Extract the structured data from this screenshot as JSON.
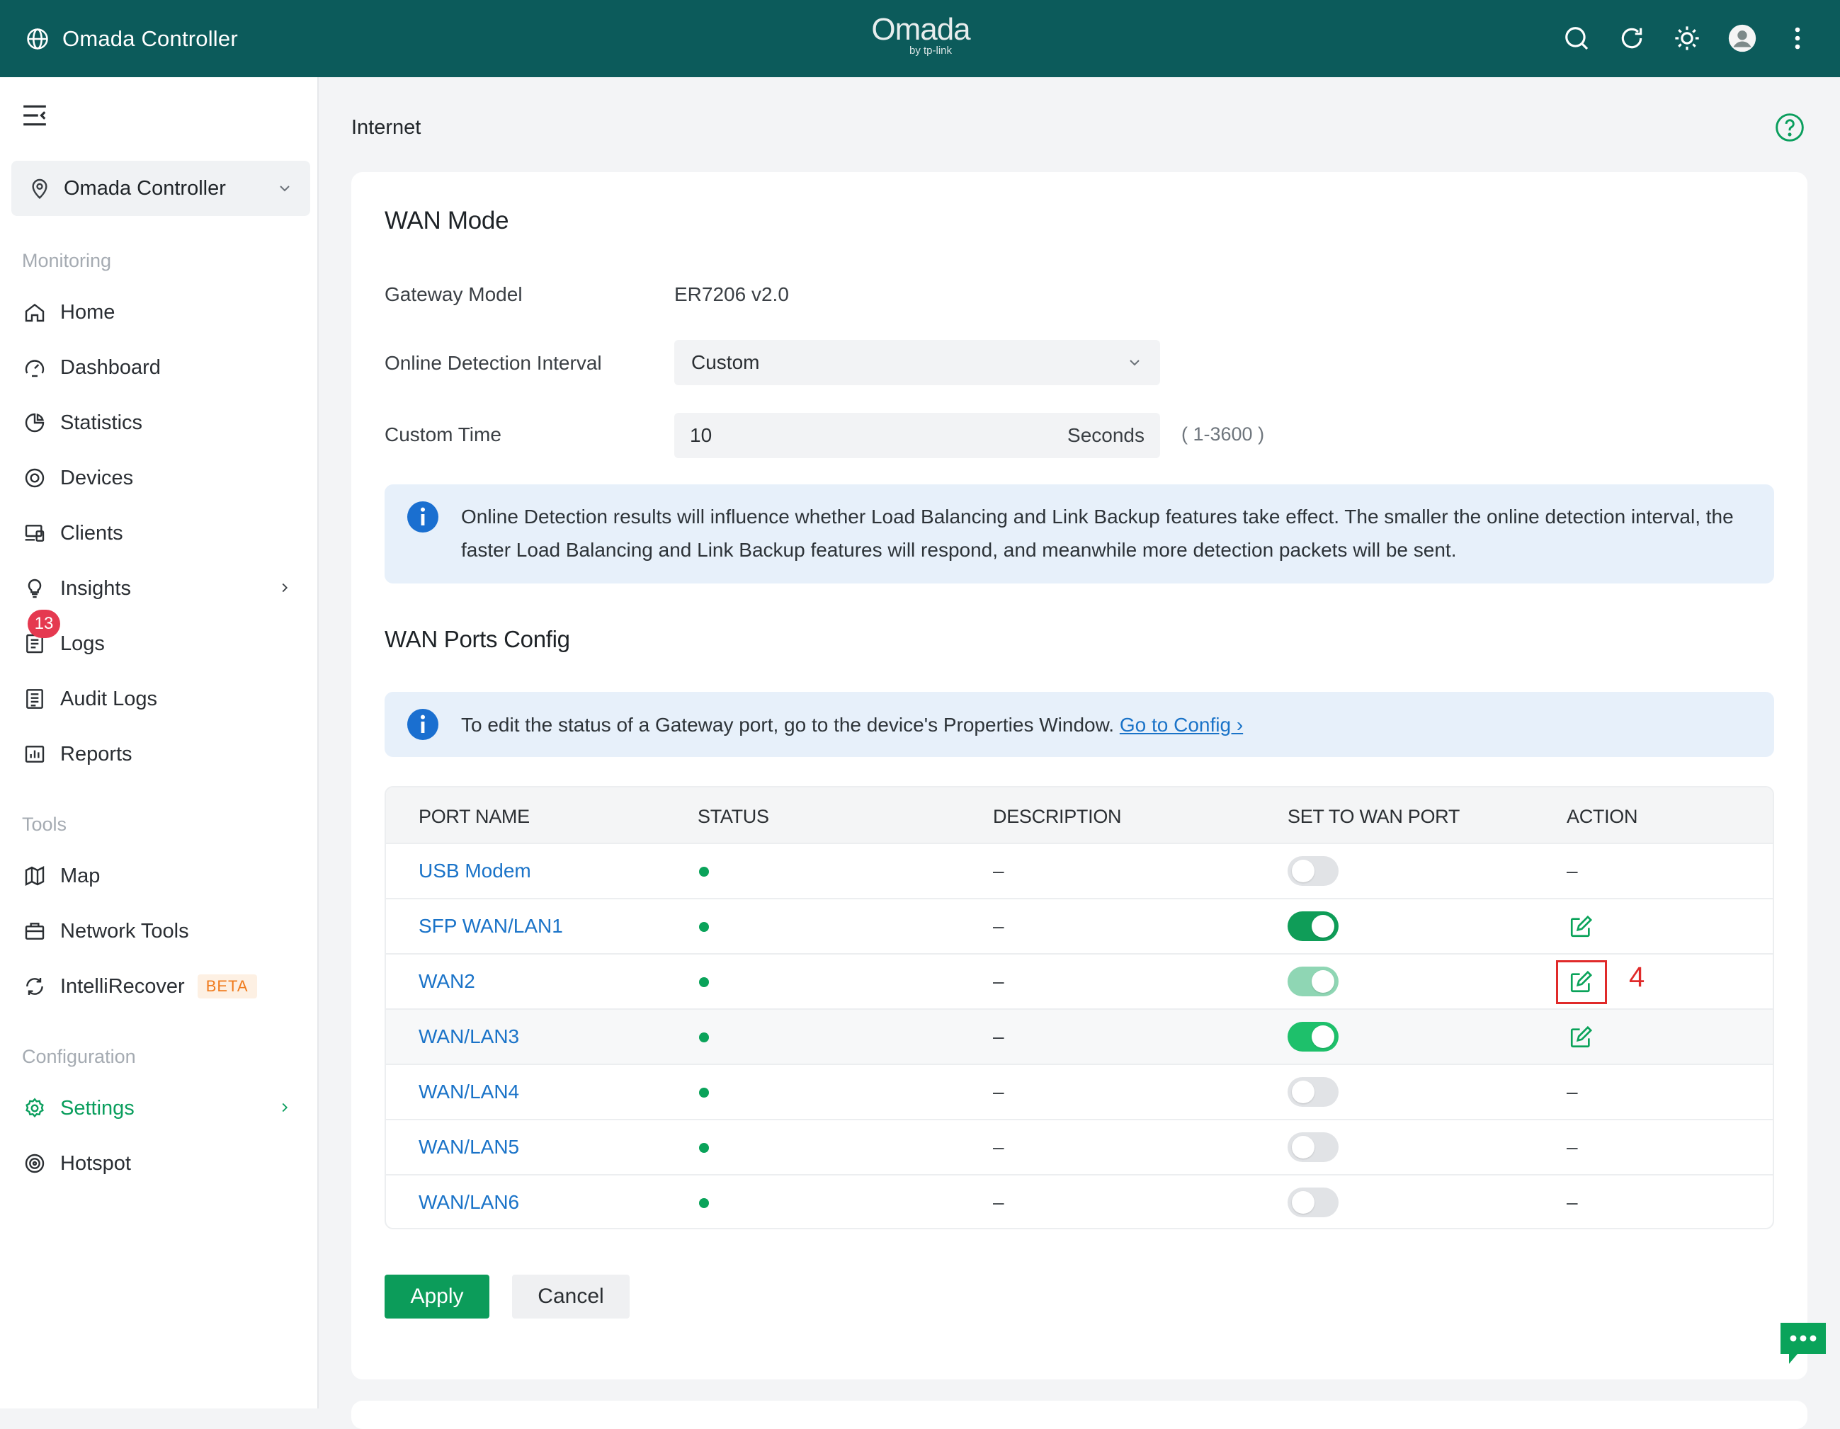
{
  "topbar": {
    "app_title": "Omada Controller",
    "brand": "Omada",
    "brand_sub": "by tp-link",
    "icons": [
      "search-icon",
      "refresh-icon",
      "theme-sun-icon",
      "user-avatar-icon",
      "more-vertical-icon"
    ]
  },
  "sidebar": {
    "site": "Omada Controller",
    "sections": {
      "monitoring": "Monitoring",
      "tools": "Tools",
      "configuration": "Configuration"
    },
    "items": {
      "home": "Home",
      "dashboard": "Dashboard",
      "statistics": "Statistics",
      "devices": "Devices",
      "clients": "Clients",
      "insights": "Insights",
      "logs": "Logs",
      "logs_badge": "13",
      "audit_logs": "Audit Logs",
      "reports": "Reports",
      "map": "Map",
      "network_tools": "Network Tools",
      "intellirecover": "IntelliRecover",
      "intellirecover_badge": "BETA",
      "settings": "Settings",
      "hotspot": "Hotspot"
    },
    "active_item": "settings"
  },
  "main": {
    "page_title": "Internet",
    "wan_mode": {
      "title": "WAN Mode",
      "gateway_model_label": "Gateway Model",
      "gateway_model_value": "ER7206 v2.0",
      "interval_label": "Online Detection Interval",
      "interval_value": "Custom",
      "custom_time_label": "Custom Time",
      "custom_time_value": "10",
      "custom_time_unit": "Seconds",
      "custom_time_range": "( 1-3600 )",
      "info_text": "Online Detection results will influence whether Load Balancing and Link Backup features take effect. The smaller the online detection interval, the faster Load Balancing and Link Backup features will respond, and meanwhile more detection packets will be sent."
    },
    "wan_ports": {
      "title": "WAN Ports Config",
      "info_text": "To edit the status of a Gateway port, go to the device's Properties Window.",
      "info_link": "Go to Config ›",
      "columns": {
        "port_name": "PORT NAME",
        "status": "STATUS",
        "description": "DESCRIPTION",
        "set_to_wan": "SET TO WAN PORT",
        "action": "ACTION"
      },
      "rows": [
        {
          "port": "USB Modem",
          "description": "–",
          "wan": false,
          "action": "–"
        },
        {
          "port": "SFP WAN/LAN1",
          "description": "–",
          "wan": true,
          "action": "edit"
        },
        {
          "port": "WAN2",
          "description": "–",
          "wan": true,
          "action": "edit"
        },
        {
          "port": "WAN/LAN3",
          "description": "–",
          "wan": true,
          "action": "edit"
        },
        {
          "port": "WAN/LAN4",
          "description": "–",
          "wan": false,
          "action": "–"
        },
        {
          "port": "WAN/LAN5",
          "description": "–",
          "wan": false,
          "action": "–"
        },
        {
          "port": "WAN/LAN6",
          "description": "–",
          "wan": false,
          "action": "–"
        }
      ],
      "status_color": "#0aa35a",
      "annotation": "4"
    },
    "buttons": {
      "apply": "Apply",
      "cancel": "Cancel"
    }
  },
  "colors": {
    "topbar": "#0c5b5b",
    "accent": "#0c9c5a",
    "link": "#1a73c8",
    "annotation": "#e02a2a"
  }
}
